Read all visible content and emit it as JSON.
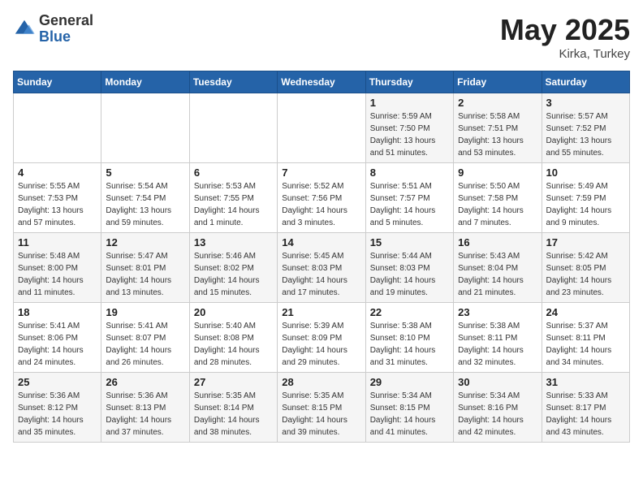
{
  "header": {
    "logo_general": "General",
    "logo_blue": "Blue",
    "title": "May 2025",
    "location": "Kirka, Turkey"
  },
  "weekdays": [
    "Sunday",
    "Monday",
    "Tuesday",
    "Wednesday",
    "Thursday",
    "Friday",
    "Saturday"
  ],
  "weeks": [
    [
      {
        "day": "",
        "info": ""
      },
      {
        "day": "",
        "info": ""
      },
      {
        "day": "",
        "info": ""
      },
      {
        "day": "",
        "info": ""
      },
      {
        "day": "1",
        "info": "Sunrise: 5:59 AM\nSunset: 7:50 PM\nDaylight: 13 hours\nand 51 minutes."
      },
      {
        "day": "2",
        "info": "Sunrise: 5:58 AM\nSunset: 7:51 PM\nDaylight: 13 hours\nand 53 minutes."
      },
      {
        "day": "3",
        "info": "Sunrise: 5:57 AM\nSunset: 7:52 PM\nDaylight: 13 hours\nand 55 minutes."
      }
    ],
    [
      {
        "day": "4",
        "info": "Sunrise: 5:55 AM\nSunset: 7:53 PM\nDaylight: 13 hours\nand 57 minutes."
      },
      {
        "day": "5",
        "info": "Sunrise: 5:54 AM\nSunset: 7:54 PM\nDaylight: 13 hours\nand 59 minutes."
      },
      {
        "day": "6",
        "info": "Sunrise: 5:53 AM\nSunset: 7:55 PM\nDaylight: 14 hours\nand 1 minute."
      },
      {
        "day": "7",
        "info": "Sunrise: 5:52 AM\nSunset: 7:56 PM\nDaylight: 14 hours\nand 3 minutes."
      },
      {
        "day": "8",
        "info": "Sunrise: 5:51 AM\nSunset: 7:57 PM\nDaylight: 14 hours\nand 5 minutes."
      },
      {
        "day": "9",
        "info": "Sunrise: 5:50 AM\nSunset: 7:58 PM\nDaylight: 14 hours\nand 7 minutes."
      },
      {
        "day": "10",
        "info": "Sunrise: 5:49 AM\nSunset: 7:59 PM\nDaylight: 14 hours\nand 9 minutes."
      }
    ],
    [
      {
        "day": "11",
        "info": "Sunrise: 5:48 AM\nSunset: 8:00 PM\nDaylight: 14 hours\nand 11 minutes."
      },
      {
        "day": "12",
        "info": "Sunrise: 5:47 AM\nSunset: 8:01 PM\nDaylight: 14 hours\nand 13 minutes."
      },
      {
        "day": "13",
        "info": "Sunrise: 5:46 AM\nSunset: 8:02 PM\nDaylight: 14 hours\nand 15 minutes."
      },
      {
        "day": "14",
        "info": "Sunrise: 5:45 AM\nSunset: 8:03 PM\nDaylight: 14 hours\nand 17 minutes."
      },
      {
        "day": "15",
        "info": "Sunrise: 5:44 AM\nSunset: 8:03 PM\nDaylight: 14 hours\nand 19 minutes."
      },
      {
        "day": "16",
        "info": "Sunrise: 5:43 AM\nSunset: 8:04 PM\nDaylight: 14 hours\nand 21 minutes."
      },
      {
        "day": "17",
        "info": "Sunrise: 5:42 AM\nSunset: 8:05 PM\nDaylight: 14 hours\nand 23 minutes."
      }
    ],
    [
      {
        "day": "18",
        "info": "Sunrise: 5:41 AM\nSunset: 8:06 PM\nDaylight: 14 hours\nand 24 minutes."
      },
      {
        "day": "19",
        "info": "Sunrise: 5:41 AM\nSunset: 8:07 PM\nDaylight: 14 hours\nand 26 minutes."
      },
      {
        "day": "20",
        "info": "Sunrise: 5:40 AM\nSunset: 8:08 PM\nDaylight: 14 hours\nand 28 minutes."
      },
      {
        "day": "21",
        "info": "Sunrise: 5:39 AM\nSunset: 8:09 PM\nDaylight: 14 hours\nand 29 minutes."
      },
      {
        "day": "22",
        "info": "Sunrise: 5:38 AM\nSunset: 8:10 PM\nDaylight: 14 hours\nand 31 minutes."
      },
      {
        "day": "23",
        "info": "Sunrise: 5:38 AM\nSunset: 8:11 PM\nDaylight: 14 hours\nand 32 minutes."
      },
      {
        "day": "24",
        "info": "Sunrise: 5:37 AM\nSunset: 8:11 PM\nDaylight: 14 hours\nand 34 minutes."
      }
    ],
    [
      {
        "day": "25",
        "info": "Sunrise: 5:36 AM\nSunset: 8:12 PM\nDaylight: 14 hours\nand 35 minutes."
      },
      {
        "day": "26",
        "info": "Sunrise: 5:36 AM\nSunset: 8:13 PM\nDaylight: 14 hours\nand 37 minutes."
      },
      {
        "day": "27",
        "info": "Sunrise: 5:35 AM\nSunset: 8:14 PM\nDaylight: 14 hours\nand 38 minutes."
      },
      {
        "day": "28",
        "info": "Sunrise: 5:35 AM\nSunset: 8:15 PM\nDaylight: 14 hours\nand 39 minutes."
      },
      {
        "day": "29",
        "info": "Sunrise: 5:34 AM\nSunset: 8:15 PM\nDaylight: 14 hours\nand 41 minutes."
      },
      {
        "day": "30",
        "info": "Sunrise: 5:34 AM\nSunset: 8:16 PM\nDaylight: 14 hours\nand 42 minutes."
      },
      {
        "day": "31",
        "info": "Sunrise: 5:33 AM\nSunset: 8:17 PM\nDaylight: 14 hours\nand 43 minutes."
      }
    ]
  ]
}
